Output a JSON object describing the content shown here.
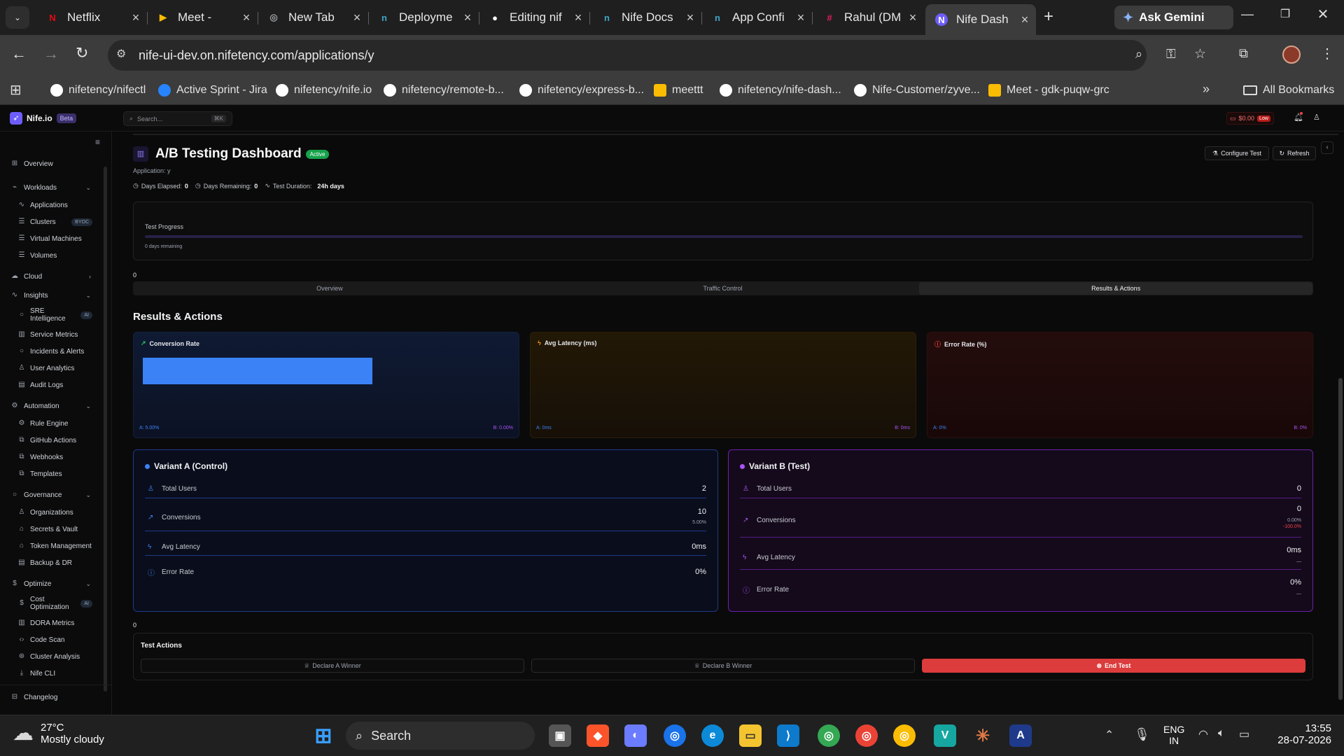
{
  "browser": {
    "tabs": [
      {
        "title": "Netflix",
        "icon": "netflix-icon",
        "color": "#e50914",
        "glyph": "N"
      },
      {
        "title": "Meet -",
        "icon": "meet-icon",
        "color": "#fbbc04",
        "glyph": "▶"
      },
      {
        "title": "New Tab",
        "icon": "chrome-icon",
        "color": "#9aa0a6",
        "glyph": "◎"
      },
      {
        "title": "Deployme",
        "icon": "nife-icon",
        "color": "#3ea6c9",
        "glyph": "n"
      },
      {
        "title": "Editing nif",
        "icon": "github-icon",
        "color": "#ffffff",
        "glyph": "●"
      },
      {
        "title": "Nife Docs",
        "icon": "nife-icon",
        "color": "#3ea6c9",
        "glyph": "n"
      },
      {
        "title": "App Confi",
        "icon": "nife-icon",
        "color": "#3ea6c9",
        "glyph": "n"
      },
      {
        "title": "Rahul (DM",
        "icon": "slack-icon",
        "color": "#e01e5a",
        "glyph": "#"
      },
      {
        "title": "Nife Dash",
        "icon": "nife-dashboard-icon",
        "color": "#6d5dfc",
        "glyph": "N"
      }
    ],
    "ask_gemini": "Ask Gemini",
    "url": "nife-ui-dev.on.nifetency.com/applications/y",
    "bookmarks": [
      {
        "label": "nifetency/nifectl",
        "color": "#ffffff"
      },
      {
        "label": "Active Sprint - Jira",
        "color": "#2684ff"
      },
      {
        "label": "nifetency/nife.io",
        "color": "#ffffff"
      },
      {
        "label": "nifetency/remote-b...",
        "color": "#ffffff"
      },
      {
        "label": "nifetency/express-b...",
        "color": "#ffffff"
      },
      {
        "label": "meettt",
        "color": "#fbbc04"
      },
      {
        "label": "nifetency/nife-dash...",
        "color": "#ffffff"
      },
      {
        "label": "Nife-Customer/zyve...",
        "color": "#ffffff"
      },
      {
        "label": "Meet - gdk-puqw-grc",
        "color": "#fbbc04"
      }
    ],
    "all_bookmarks": "All Bookmarks"
  },
  "app": {
    "brand": "Nife.io",
    "brand_badge": "Beta",
    "search_placeholder": "Search...",
    "search_shortcut": "⌘K",
    "credit": "$0.00",
    "credit_badge": "Low",
    "sidebar": {
      "overview": "Overview",
      "groups": [
        {
          "label": "Workloads",
          "items": [
            {
              "label": "Applications",
              "icon": "∿"
            },
            {
              "label": "Clusters",
              "icon": "☰",
              "badge": "BYOC"
            },
            {
              "label": "Virtual Machines",
              "icon": "☰"
            },
            {
              "label": "Volumes",
              "icon": "☰"
            }
          ]
        },
        {
          "label": "Cloud",
          "items": []
        },
        {
          "label": "Insights",
          "items": [
            {
              "label": "SRE Intelligence",
              "icon": "○",
              "badge": "AI"
            },
            {
              "label": "Service Metrics",
              "icon": "▥"
            },
            {
              "label": "Incidents & Alerts",
              "icon": "○"
            },
            {
              "label": "User Analytics",
              "icon": "♙"
            },
            {
              "label": "Audit Logs",
              "icon": "▤"
            }
          ]
        },
        {
          "label": "Automation",
          "items": [
            {
              "label": "Rule Engine",
              "icon": "⚙"
            },
            {
              "label": "GitHub Actions",
              "icon": "⧉"
            },
            {
              "label": "Webhooks",
              "icon": "⧉"
            },
            {
              "label": "Templates",
              "icon": "⧉"
            }
          ]
        },
        {
          "label": "Governance",
          "items": [
            {
              "label": "Organizations",
              "icon": "♙"
            },
            {
              "label": "Secrets & Vault",
              "icon": "⌂"
            },
            {
              "label": "Token Management",
              "icon": "⌂"
            },
            {
              "label": "Backup & DR",
              "icon": "▤"
            }
          ]
        },
        {
          "label": "Optimize",
          "items": [
            {
              "label": "Cost Optimization",
              "icon": "$",
              "badge": "AI"
            },
            {
              "label": "DORA Metrics",
              "icon": "▥"
            },
            {
              "label": "Code Scan",
              "icon": "‹›"
            },
            {
              "label": "Cluster Analysis",
              "icon": "⊛"
            },
            {
              "label": "Nife CLI",
              "icon": "⤓"
            }
          ]
        }
      ],
      "changelog": "Changelog"
    },
    "header": {
      "title": "A/B Testing Dashboard",
      "status": "Active",
      "application_label": "Application: y",
      "days_elapsed_label": "Days Elapsed:",
      "days_elapsed": "0",
      "days_remaining_label": "Days Remaining:",
      "days_remaining": "0",
      "duration_label": "Test Duration:",
      "duration": "24h days",
      "configure": "Configure Test",
      "refresh": "Refresh"
    },
    "progress": {
      "label": "Test Progress",
      "sub": "0 days remaining",
      "value": 0
    },
    "stray_zero_1": "0",
    "stray_zero_2": "0",
    "tabs": [
      "Overview",
      "Traffic Control",
      "Results & Actions"
    ],
    "section_title": "Results & Actions",
    "metric_cards": [
      {
        "title": "Conversion Rate",
        "a": "A: 5.00%",
        "b": "B: 0.00%",
        "a_value": 5.0,
        "b_value": 0.0
      },
      {
        "title": "Avg Latency (ms)",
        "a": "A: 0ms",
        "b": "B: 0ms"
      },
      {
        "title": "Error Rate (%)",
        "a": "A: 0%",
        "b": "B: 0%"
      }
    ],
    "variant_a": {
      "title": "Variant A (Control)",
      "total_users_label": "Total Users",
      "total_users": "2",
      "conversions_label": "Conversions",
      "conversions": "10",
      "conversions_pct": "5.00%",
      "latency_label": "Avg Latency",
      "latency": "0ms",
      "error_label": "Error Rate",
      "error": "0%"
    },
    "variant_b": {
      "title": "Variant B (Test)",
      "total_users_label": "Total Users",
      "total_users": "0",
      "conversions_label": "Conversions",
      "conversions": "0",
      "conversions_pct": "0.00%",
      "conversions_delta": "-100.0%",
      "latency_label": "Avg Latency",
      "latency": "0ms",
      "latency_delta": "—",
      "error_label": "Error Rate",
      "error": "0%",
      "error_delta": "—"
    },
    "actions": {
      "title": "Test Actions",
      "declare_a": "Declare A Winner",
      "declare_b": "Declare B Winner",
      "end": "End Test"
    }
  },
  "taskbar": {
    "temp": "27°C",
    "weather": "Mostly cloudy",
    "search": "Search",
    "lang1": "ENG",
    "lang2": "IN",
    "time": "13:55",
    "date": "28-07-2026"
  }
}
